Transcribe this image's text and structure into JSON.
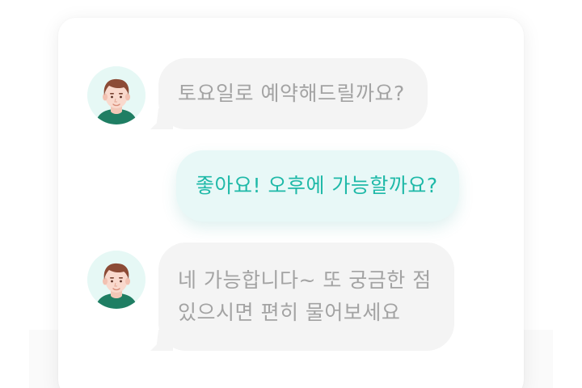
{
  "colors": {
    "incoming_bubble": "#f4f4f4",
    "incoming_text": "#a3a3a3",
    "outgoing_bubble": "#e8f8f7",
    "outgoing_text": "#1fb9a8",
    "avatar_background": "#e6f8f5"
  },
  "messages": [
    {
      "sender": "agent",
      "avatar": "man-avatar-icon",
      "lines": [
        "토요일로 예약해드릴까요?"
      ]
    },
    {
      "sender": "user",
      "lines": [
        "좋아요! 오후에 가능할까요?"
      ]
    },
    {
      "sender": "agent",
      "avatar": "man-avatar-icon",
      "lines": [
        "네 가능합니다~ 또 궁금한 점",
        "있으시면 편히 물어보세요"
      ]
    }
  ]
}
